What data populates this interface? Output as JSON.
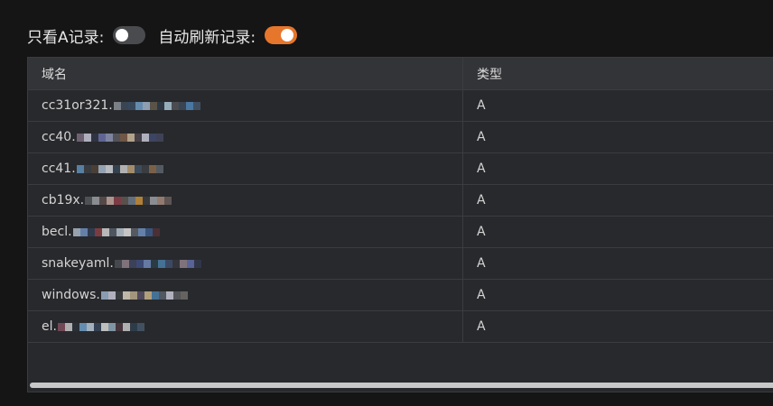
{
  "toggles": {
    "a_records_only": {
      "label": "只看A记录:",
      "on": false
    },
    "auto_refresh": {
      "label": "自动刷新记录:",
      "on": true
    }
  },
  "table": {
    "headers": {
      "domain": "域名",
      "type": "类型"
    },
    "rows": [
      {
        "domain": "cc31or321.",
        "type": "A",
        "redacted": true
      },
      {
        "domain": "cc40.",
        "type": "A",
        "redacted": true
      },
      {
        "domain": "cc41.",
        "type": "A",
        "redacted": true
      },
      {
        "domain": "cb19x.",
        "type": "A",
        "redacted": true
      },
      {
        "domain": "becl.",
        "type": "A",
        "redacted": true
      },
      {
        "domain": "snakeyaml.",
        "type": "A",
        "redacted": true
      },
      {
        "domain": "windows.",
        "type": "A",
        "redacted": true
      },
      {
        "domain": "el.",
        "type": "A",
        "redacted": true
      }
    ]
  },
  "colors": {
    "accent": "#e6762c",
    "toggle_off": "#4a4b4e",
    "table_bg": "#28292c"
  }
}
